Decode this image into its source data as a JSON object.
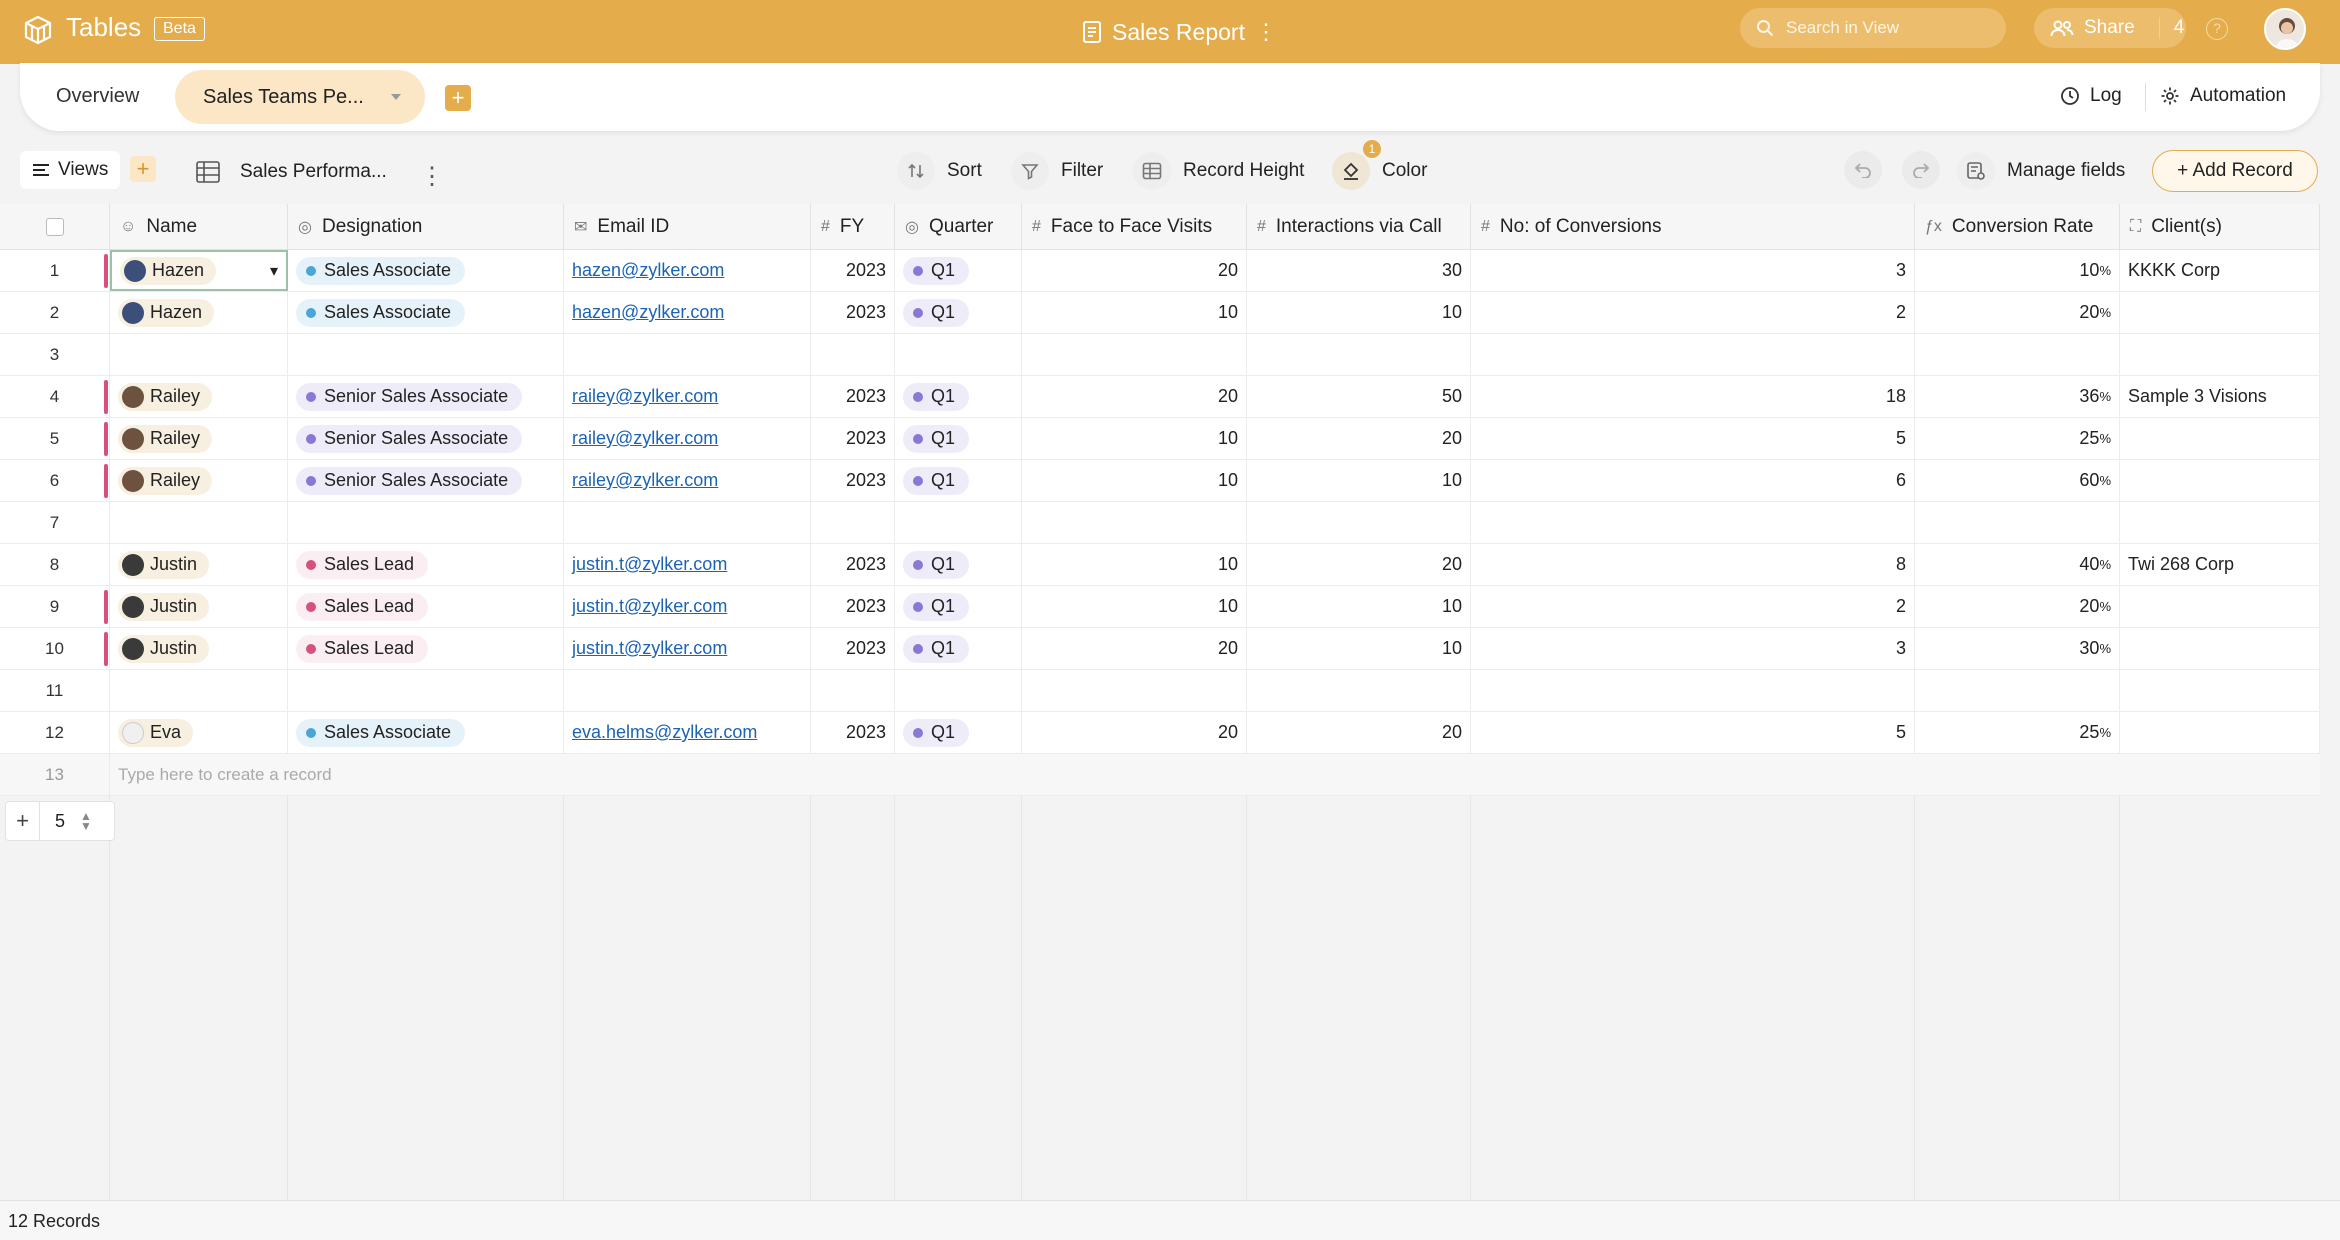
{
  "app": {
    "name": "Tables",
    "badge": "Beta",
    "document_title": "Sales Report",
    "search_placeholder": "Search in View",
    "share_label": "Share",
    "share_count": "4"
  },
  "tabs": {
    "overview": "Overview",
    "active": "Sales Teams Pe...",
    "log": "Log",
    "automation": "Automation"
  },
  "toolbar": {
    "views": "Views",
    "view_name": "Sales Performa...",
    "sort": "Sort",
    "filter": "Filter",
    "record_height": "Record Height",
    "color": "Color",
    "color_badge": "1",
    "manage_fields": "Manage fields",
    "add_record": "+ Add Record"
  },
  "columns": [
    "Name",
    "Designation",
    "Email ID",
    "FY",
    "Quarter",
    "Face to Face Visits",
    "Interactions via Call",
    "No: of Conversions",
    "Conversion Rate",
    "Client(s)"
  ],
  "rows": [
    {
      "n": "1",
      "name": "Hazen",
      "designation": "Sales Associate",
      "email": "hazen@zylker.com",
      "fy": "2023",
      "quarter": "Q1",
      "visits": "20",
      "calls": "30",
      "conv": "3",
      "rate": "10",
      "client": "KKKK Corp"
    },
    {
      "n": "2",
      "name": "Hazen",
      "designation": "Sales Associate",
      "email": "hazen@zylker.com",
      "fy": "2023",
      "quarter": "Q1",
      "visits": "10",
      "calls": "10",
      "conv": "2",
      "rate": "20",
      "client": ""
    },
    {
      "n": "3"
    },
    {
      "n": "4",
      "name": "Railey",
      "designation": "Senior Sales Associate",
      "email": "railey@zylker.com",
      "fy": "2023",
      "quarter": "Q1",
      "visits": "20",
      "calls": "50",
      "conv": "18",
      "rate": "36",
      "client": "Sample 3 Visions"
    },
    {
      "n": "5",
      "name": "Railey",
      "designation": "Senior Sales Associate",
      "email": "railey@zylker.com",
      "fy": "2023",
      "quarter": "Q1",
      "visits": "10",
      "calls": "20",
      "conv": "5",
      "rate": "25",
      "client": ""
    },
    {
      "n": "6",
      "name": "Railey",
      "designation": "Senior Sales Associate",
      "email": "railey@zylker.com",
      "fy": "2023",
      "quarter": "Q1",
      "visits": "10",
      "calls": "10",
      "conv": "6",
      "rate": "60",
      "client": ""
    },
    {
      "n": "7"
    },
    {
      "n": "8",
      "name": "Justin",
      "designation": "Sales Lead",
      "email": "justin.t@zylker.com",
      "fy": "2023",
      "quarter": "Q1",
      "visits": "10",
      "calls": "20",
      "conv": "8",
      "rate": "40",
      "client": "Twi 268 Corp"
    },
    {
      "n": "9",
      "name": "Justin",
      "designation": "Sales Lead",
      "email": "justin.t@zylker.com",
      "fy": "2023",
      "quarter": "Q1",
      "visits": "10",
      "calls": "10",
      "conv": "2",
      "rate": "20",
      "client": ""
    },
    {
      "n": "10",
      "name": "Justin",
      "designation": "Sales Lead",
      "email": "justin.t@zylker.com",
      "fy": "2023",
      "quarter": "Q1",
      "visits": "20",
      "calls": "10",
      "conv": "3",
      "rate": "30",
      "client": ""
    },
    {
      "n": "11"
    },
    {
      "n": "12",
      "name": "Eva",
      "designation": "Sales Associate",
      "email": "eva.helms@zylker.com",
      "fy": "2023",
      "quarter": "Q1",
      "visits": "20",
      "calls": "20",
      "conv": "5",
      "rate": "25",
      "client": ""
    }
  ],
  "new_row": {
    "n": "13",
    "placeholder": "Type here to create a record"
  },
  "percent_suffix": "%",
  "pager": {
    "value": "5",
    "add": "+"
  },
  "footer": {
    "record_count": "12 Records"
  },
  "colors": {
    "brand": "#e5ac4b",
    "associate_dot": "#4aa6d6",
    "senior_dot": "#8a77d6",
    "lead_dot": "#d8507d",
    "quarter_dot": "#8a77d6",
    "row_marker": "#d8507d",
    "link": "#1b63b5"
  }
}
